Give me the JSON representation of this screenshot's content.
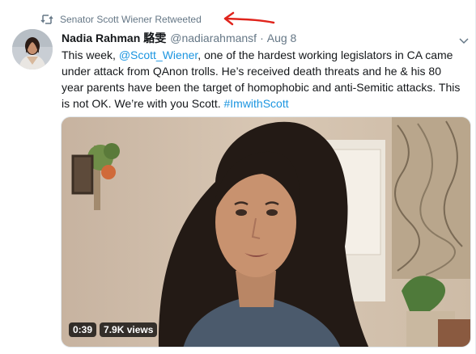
{
  "retweet": {
    "icon": "retweet-icon",
    "label": "Senator Scott Wiener Retweeted"
  },
  "tweet": {
    "author_name": "Nadia Rahman",
    "author_name_extra": "駱雯",
    "handle": "@nadiarahmansf",
    "separator": "·",
    "time": "Aug 8",
    "text": {
      "t1": "This week, ",
      "mention": "@Scott_Wiener",
      "t2": ", one of the hardest working legislators in CA came under attack from QAnon trolls. He’s received death threats and he & his 80 year parents have been the target of homophobic and anti-Semitic attacks. This is not OK. We’re with you Scott. ",
      "hashtag": "#ImwithScott"
    }
  },
  "media": {
    "duration": "0:39",
    "views": "7.9K views"
  },
  "colors": {
    "link": "#1b95e0",
    "secondary_text": "#657786",
    "annotation": "#e0241c"
  }
}
